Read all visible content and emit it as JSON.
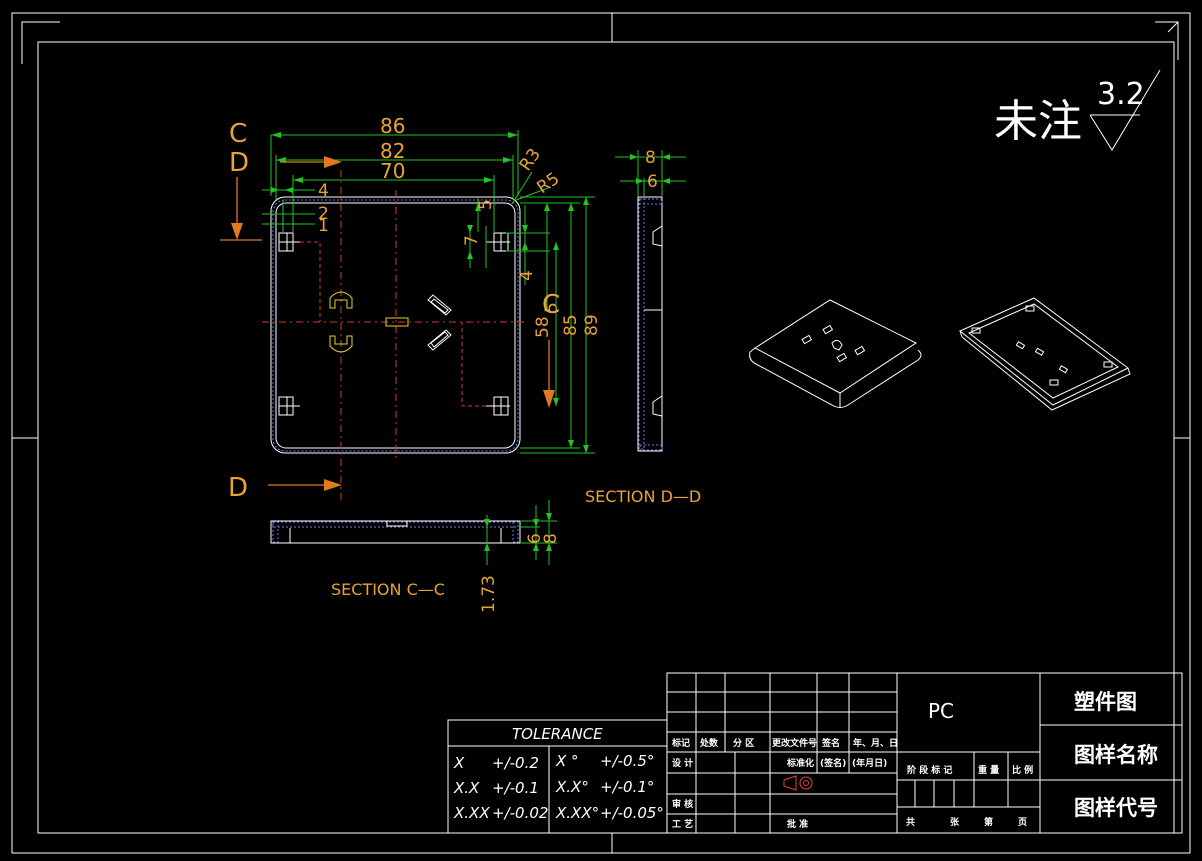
{
  "surface_note": {
    "main": "未注",
    "value": "3.2"
  },
  "front_view": {
    "section_letters": {
      "c_top": "C",
      "d_top": "D",
      "d_bottom": "D",
      "c_right": "C"
    },
    "dims": {
      "w86": "86",
      "w82": "82",
      "w70": "70",
      "w4": "4",
      "w2": "2",
      "w1": "1",
      "r3": "R3",
      "r5": "R5",
      "h5": "5",
      "h7": "7",
      "h4": "4",
      "v5": "5",
      "v58": "58",
      "v85": "85",
      "v89": "89"
    }
  },
  "section_dd": {
    "label": "SECTION  D—D",
    "dims": {
      "d8": "8",
      "d6": "6"
    }
  },
  "section_cc": {
    "label": "SECTION  C—C",
    "dims": {
      "d6": "6",
      "d8": "8",
      "d173": "1.73"
    }
  },
  "tolerance": {
    "title": "TOLERANCE",
    "rows": [
      {
        "a": "X",
        "b": "+/-0.2",
        "c": "X °",
        "d": "+/-0.5°"
      },
      {
        "a": "X.X",
        "b": "+/-0.1",
        "c": "X.X°",
        "d": "+/-0.1°"
      },
      {
        "a": "X.XX",
        "b": "+/-0.02",
        "c": "X.XX°",
        "d": "+/-0.05°"
      }
    ]
  },
  "title_block": {
    "material": "PC",
    "drawing_type": "塑件图",
    "drawing_name": "图样名称",
    "drawing_code": "图样代号",
    "row_labels": {
      "mark": "标记",
      "count": "处数",
      "zone": "分 区",
      "change_doc": "更改文件号",
      "sign": "签名",
      "date": "年、月、日",
      "design": "设 计",
      "standard": "标准化",
      "sign2": "(签名)",
      "date2": "(年月日)",
      "check": "审 核",
      "process": "工 艺",
      "approve": "批 准",
      "stage": "阶 段 标 记",
      "weight": "重 量",
      "scale": "比 例",
      "total": "共",
      "sheets": "张",
      "sheet_no": "第",
      "page": "页"
    }
  }
}
